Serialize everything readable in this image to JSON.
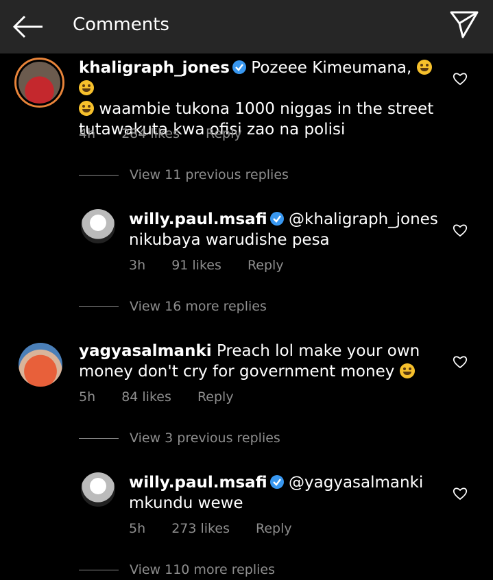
{
  "header": {
    "title": "Comments",
    "back_icon": "arrow-left-icon",
    "share_icon": "paper-plane-icon"
  },
  "comments": [
    {
      "username": "khaligraph_jones",
      "verified": true,
      "text_line1": "Pozeee Kimeumana,",
      "text_line2": "waambie tukona 1000 niggas in the street",
      "text_line3": "tutawakuta kwa ofisi zao na polisi",
      "time": "4h",
      "likes": "284 likes",
      "reply": "Reply"
    },
    {
      "view_label": "View 11 previous replies"
    },
    {
      "username": "willy.paul.msafi",
      "verified": true,
      "mention": "@khaligraph_jones",
      "text_line2": "nikubaya warudishe pesa",
      "time": "3h",
      "likes": "91 likes",
      "reply": "Reply"
    },
    {
      "view_label": "View 16 more replies"
    },
    {
      "username": "yagyasalmanki",
      "text_line1": "Preach lol make your own",
      "text_line2": "money don't cry for government money",
      "time": "5h",
      "likes": "84 likes",
      "reply": "Reply"
    },
    {
      "view_label": "View 3 previous replies"
    },
    {
      "username": "willy.paul.msafi",
      "verified": true,
      "mention": "@yagyasalmanki",
      "text_line2": "mkundu wewe",
      "time": "5h",
      "likes": "273 likes",
      "reply": "Reply"
    },
    {
      "view_label": "View 110 more replies"
    }
  ],
  "colors": {
    "background": "#000000",
    "header": "#262626",
    "muted": "#8e8e8e",
    "verified": "#3897f0",
    "story_ring": "#e8843a"
  }
}
